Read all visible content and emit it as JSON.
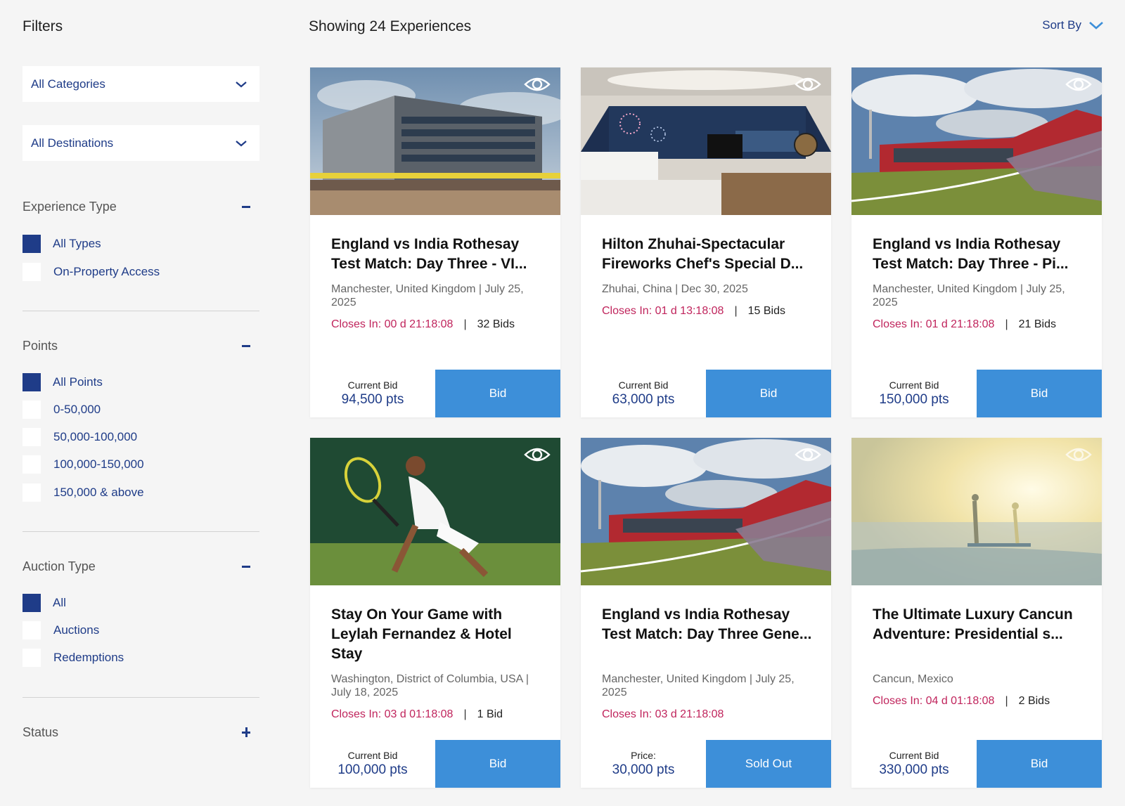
{
  "sidebar": {
    "title": "Filters",
    "categories_label": "All Categories",
    "destinations_label": "All Destinations",
    "experience_type": {
      "title": "Experience Type",
      "options": [
        "All Types",
        "On-Property Access"
      ]
    },
    "points": {
      "title": "Points",
      "options": [
        "All Points",
        "0-50,000",
        "50,000-100,000",
        "100,000-150,000",
        "150,000 & above"
      ]
    },
    "auction_type": {
      "title": "Auction Type",
      "options": [
        "All",
        "Auctions",
        "Redemptions"
      ]
    },
    "status": {
      "title": "Status"
    }
  },
  "header": {
    "showing": "Showing 24 Experiences",
    "sort_label": "Sort By"
  },
  "cards": [
    {
      "title": "England vs India Rothesay Test Match: Day Three - VI...",
      "location": "Manchester, United Kingdom | July 25, 2025",
      "closes": "Closes In: 00 d 21:18:08",
      "bids": "32 Bids",
      "price_label": "Current Bid",
      "price": "94,500 pts",
      "button": "Bid"
    },
    {
      "title": "Hilton Zhuhai-Spectacular Fireworks Chef's Special D...",
      "location": "Zhuhai, China | Dec 30, 2025",
      "closes": "Closes In: 01 d 13:18:08",
      "bids": "15 Bids",
      "price_label": "Current Bid",
      "price": "63,000 pts",
      "button": "Bid"
    },
    {
      "title": "England vs India Rothesay Test Match: Day Three - Pi...",
      "location": "Manchester, United Kingdom | July 25, 2025",
      "closes": "Closes In: 01 d 21:18:08",
      "bids": "21 Bids",
      "price_label": "Current Bid",
      "price": "150,000 pts",
      "button": "Bid"
    },
    {
      "title": "Stay On Your Game with Leylah Fernandez & Hotel Stay",
      "location": "Washington, District of Columbia, USA | July 18, 2025",
      "closes": "Closes In: 03 d 01:18:08",
      "bids": "1 Bid",
      "price_label": "Current Bid",
      "price": "100,000 pts",
      "button": "Bid"
    },
    {
      "title": "England vs India Rothesay Test Match: Day Three Gene...",
      "location": "Manchester, United Kingdom | July 25, 2025",
      "closes": "Closes In: 03 d 21:18:08",
      "bids": "",
      "price_label": "Price:",
      "price": "30,000 pts",
      "button": "Sold Out"
    },
    {
      "title": "The Ultimate Luxury Cancun Adventure: Presidential s...",
      "location": "Cancun, Mexico",
      "closes": "Closes In: 04 d 01:18:08",
      "bids": "2 Bids",
      "price_label": "Current Bid",
      "price": "330,000 pts",
      "button": "Bid"
    }
  ],
  "icons": {
    "chevron": "chevron-down-icon",
    "eye": "eye-icon",
    "minus": "minus-icon",
    "plus": "plus-icon"
  },
  "colors": {
    "brand": "#1f3c88",
    "button": "#3d8fd9",
    "closes": "#c0245c",
    "background": "#f5f5f5"
  }
}
